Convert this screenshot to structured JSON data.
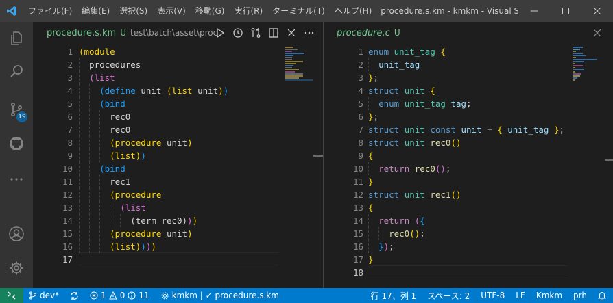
{
  "menu": [
    "ファイル(F)",
    "編集(E)",
    "選択(S)",
    "表示(V)",
    "移動(G)",
    "実行(R)",
    "ターミナル(T)",
    "ヘルプ(H)"
  ],
  "window_title": "procedure.s.km - kmkm - Visual Studio ...",
  "activity_badge": "19",
  "left_editor": {
    "tab_name": "procedure.s.km",
    "tab_status": "U",
    "tab_path": "test\\batch\\asset\\procedur",
    "lines": [
      [
        {
          "c": "yb",
          "t": "(module"
        }
      ],
      [
        {
          "c": "pl",
          "t": "  procedures"
        }
      ],
      [
        {
          "c": "pl",
          "t": "  "
        },
        {
          "c": "pb",
          "t": "(list"
        }
      ],
      [
        {
          "c": "pl",
          "t": "    "
        },
        {
          "c": "bb",
          "t": "(define"
        },
        {
          "c": "pl",
          "t": " unit "
        },
        {
          "c": "yb",
          "t": "(list"
        },
        {
          "c": "pl",
          "t": " unit"
        },
        {
          "c": "yb",
          "t": ")"
        },
        {
          "c": "bb",
          "t": ")"
        }
      ],
      [
        {
          "c": "pl",
          "t": "    "
        },
        {
          "c": "bb",
          "t": "(bind"
        }
      ],
      [
        {
          "c": "pl",
          "t": "      rec0"
        }
      ],
      [
        {
          "c": "pl",
          "t": "      rec0"
        }
      ],
      [
        {
          "c": "pl",
          "t": "      "
        },
        {
          "c": "yb",
          "t": "(procedure"
        },
        {
          "c": "pl",
          "t": " unit"
        },
        {
          "c": "yb",
          "t": ")"
        }
      ],
      [
        {
          "c": "pl",
          "t": "      "
        },
        {
          "c": "yb",
          "t": "(list"
        },
        {
          "c": "yb",
          "t": ")"
        },
        {
          "c": "bb",
          "t": ")"
        }
      ],
      [
        {
          "c": "pl",
          "t": "    "
        },
        {
          "c": "bb",
          "t": "(bind"
        }
      ],
      [
        {
          "c": "pl",
          "t": "      rec1"
        }
      ],
      [
        {
          "c": "pl",
          "t": "      "
        },
        {
          "c": "yb",
          "t": "(procedure"
        }
      ],
      [
        {
          "c": "pl",
          "t": "        "
        },
        {
          "c": "pb",
          "t": "(list"
        }
      ],
      [
        {
          "c": "pl",
          "t": "          (term rec0"
        },
        {
          "c": "pl",
          "t": ")"
        },
        {
          "c": "pb",
          "t": ")"
        },
        {
          "c": "yb",
          "t": ")"
        }
      ],
      [
        {
          "c": "pl",
          "t": "      "
        },
        {
          "c": "yb",
          "t": "(procedure"
        },
        {
          "c": "pl",
          "t": " unit"
        },
        {
          "c": "yb",
          "t": ")"
        }
      ],
      [
        {
          "c": "pl",
          "t": "      "
        },
        {
          "c": "yb",
          "t": "(list"
        },
        {
          "c": "yb",
          "t": ")"
        },
        {
          "c": "bb",
          "t": ")"
        },
        {
          "c": "pb",
          "t": ")"
        },
        {
          "c": "yb",
          "t": ")"
        }
      ],
      [
        {
          "c": "pl",
          "t": ""
        }
      ]
    ],
    "current_line": 17
  },
  "right_editor": {
    "tab_name": "procedure.c",
    "tab_status": "U",
    "lines": [
      [
        {
          "c": "kw",
          "t": "enum"
        },
        {
          "c": "pl",
          "t": " "
        },
        {
          "c": "ty",
          "t": "unit_tag"
        },
        {
          "c": "pl",
          "t": " "
        },
        {
          "c": "yb",
          "t": "{"
        }
      ],
      [
        {
          "c": "pl",
          "t": "  "
        },
        {
          "c": "id",
          "t": "unit_tag"
        }
      ],
      [
        {
          "c": "yb",
          "t": "}"
        },
        {
          "c": "pl",
          "t": ";"
        }
      ],
      [
        {
          "c": "kw",
          "t": "struct"
        },
        {
          "c": "pl",
          "t": " "
        },
        {
          "c": "ty",
          "t": "unit"
        },
        {
          "c": "pl",
          "t": " "
        },
        {
          "c": "yb",
          "t": "{"
        }
      ],
      [
        {
          "c": "pl",
          "t": "  "
        },
        {
          "c": "kw",
          "t": "enum"
        },
        {
          "c": "pl",
          "t": " "
        },
        {
          "c": "ty",
          "t": "unit_tag"
        },
        {
          "c": "pl",
          "t": " "
        },
        {
          "c": "id",
          "t": "tag"
        },
        {
          "c": "pl",
          "t": ";"
        }
      ],
      [
        {
          "c": "yb",
          "t": "}"
        },
        {
          "c": "pl",
          "t": ";"
        }
      ],
      [
        {
          "c": "kw",
          "t": "struct"
        },
        {
          "c": "pl",
          "t": " "
        },
        {
          "c": "ty",
          "t": "unit"
        },
        {
          "c": "pl",
          "t": " "
        },
        {
          "c": "kw",
          "t": "const"
        },
        {
          "c": "pl",
          "t": " "
        },
        {
          "c": "id",
          "t": "unit"
        },
        {
          "c": "pl",
          "t": " = "
        },
        {
          "c": "yb",
          "t": "{"
        },
        {
          "c": "pl",
          "t": " "
        },
        {
          "c": "id",
          "t": "unit_tag"
        },
        {
          "c": "pl",
          "t": " "
        },
        {
          "c": "yb",
          "t": "}"
        },
        {
          "c": "pl",
          "t": ";"
        }
      ],
      [
        {
          "c": "kw",
          "t": "struct"
        },
        {
          "c": "pl",
          "t": " "
        },
        {
          "c": "ty",
          "t": "unit"
        },
        {
          "c": "pl",
          "t": " "
        },
        {
          "c": "fn",
          "t": "rec0"
        },
        {
          "c": "yb",
          "t": "()"
        }
      ],
      [
        {
          "c": "yb",
          "t": "{"
        }
      ],
      [
        {
          "c": "pl",
          "t": "  "
        },
        {
          "c": "ctl",
          "t": "return"
        },
        {
          "c": "pl",
          "t": " "
        },
        {
          "c": "fn",
          "t": "rec0"
        },
        {
          "c": "pb",
          "t": "()"
        },
        {
          "c": "pl",
          "t": ";"
        }
      ],
      [
        {
          "c": "yb",
          "t": "}"
        }
      ],
      [
        {
          "c": "kw",
          "t": "struct"
        },
        {
          "c": "pl",
          "t": " "
        },
        {
          "c": "ty",
          "t": "unit"
        },
        {
          "c": "pl",
          "t": " "
        },
        {
          "c": "fn",
          "t": "rec1"
        },
        {
          "c": "yb",
          "t": "()"
        }
      ],
      [
        {
          "c": "yb",
          "t": "{"
        }
      ],
      [
        {
          "c": "pl",
          "t": "  "
        },
        {
          "c": "ctl",
          "t": "return"
        },
        {
          "c": "pl",
          "t": " "
        },
        {
          "c": "pb",
          "t": "("
        },
        {
          "c": "bb",
          "t": "{"
        }
      ],
      [
        {
          "c": "pl",
          "t": "    "
        },
        {
          "c": "fn",
          "t": "rec0"
        },
        {
          "c": "yb",
          "t": "()"
        },
        {
          "c": "pl",
          "t": ";"
        }
      ],
      [
        {
          "c": "pl",
          "t": "  "
        },
        {
          "c": "bb",
          "t": "}"
        },
        {
          "c": "pb",
          "t": ")"
        },
        {
          "c": "pl",
          "t": ";"
        }
      ],
      [
        {
          "c": "yb",
          "t": "}"
        }
      ],
      [
        {
          "c": "pl",
          "t": ""
        }
      ]
    ],
    "current_line": 18
  },
  "status": {
    "branch": "dev*",
    "errors": "1",
    "warnings": "0",
    "infos": "11",
    "workspace": "kmkm | ✓ procedure.s.km",
    "position": "行 17、列 1",
    "spaces": "スペース: 2",
    "encoding": "UTF-8",
    "eol": "LF",
    "language": "Kmkm",
    "user": "prh"
  }
}
